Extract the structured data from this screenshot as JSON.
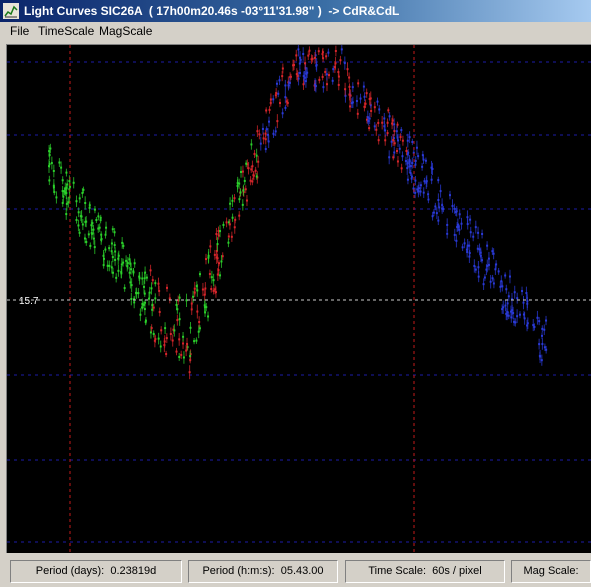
{
  "window": {
    "title": "Light Curves SIC26A  ( 17h00m20.46s -03°11'31.98\" )  -> CdR&CdL",
    "icon": "app-icon"
  },
  "menu": {
    "items": [
      "File",
      "TimeScale",
      "MagScale"
    ]
  },
  "plot": {
    "background": "#000000",
    "reference_magnitude_label": "15.7",
    "reference_line_color": "#cccccc",
    "grid_line_color": "#1c1ca8",
    "marker_line_color": "#c21a1a",
    "series_colors": {
      "green": "#2bd12b",
      "red": "#d8262b",
      "blue": "#2a3ad8"
    }
  },
  "status": {
    "period_days": "Period (days):  0.23819d",
    "period_hms": "Period (h:m:s):  05.43.00",
    "time_scale": "Time Scale:  60s / pixel",
    "mag_scale": "Mag Scale:"
  }
}
